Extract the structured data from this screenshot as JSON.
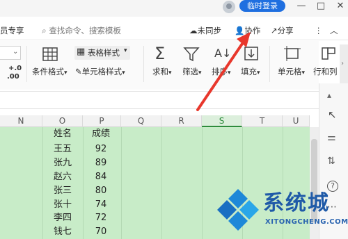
{
  "titlebar": {
    "login_label": "临时登录",
    "minimize": "—",
    "restore": "□",
    "close": "✕"
  },
  "toolbar": {
    "member_label": "员专享",
    "search_placeholder": "查找命令、搜索模板",
    "unsynced_label": "未同步",
    "collab_label": "协作",
    "share_label": "分享",
    "more_label": "⋮",
    "collapse_label": "︿"
  },
  "ribbon": {
    "cond_format": "条件格式",
    "table_style": "表格样式",
    "cell_style": "单元格样式",
    "sum": "求和",
    "filter": "筛选",
    "sort": "排序",
    "fill": "填充",
    "cell": "单元格",
    "row_col": "行和列",
    "decimal_inc": "+.0",
    "decimal_dec": ".00"
  },
  "columns": [
    "N",
    "O",
    "P",
    "Q",
    "R",
    "S",
    "T",
    "U"
  ],
  "table": {
    "header": {
      "name": "姓名",
      "score": "成绩"
    },
    "rows": [
      {
        "name": "王五",
        "score": "92"
      },
      {
        "name": "张九",
        "score": "89"
      },
      {
        "name": "赵六",
        "score": "84"
      },
      {
        "name": "张三",
        "score": "80"
      },
      {
        "name": "张十",
        "score": "74"
      },
      {
        "name": "李四",
        "score": "72"
      },
      {
        "name": "钱七",
        "score": "70"
      }
    ]
  },
  "watermark": {
    "title": "系统城",
    "url": "XITONGCHENG.COM"
  },
  "colors": {
    "accent": "#1f6fe0",
    "grid_fill": "#c8ecc8",
    "arrow": "#e8372c",
    "watermark": "#1f5aa8"
  }
}
